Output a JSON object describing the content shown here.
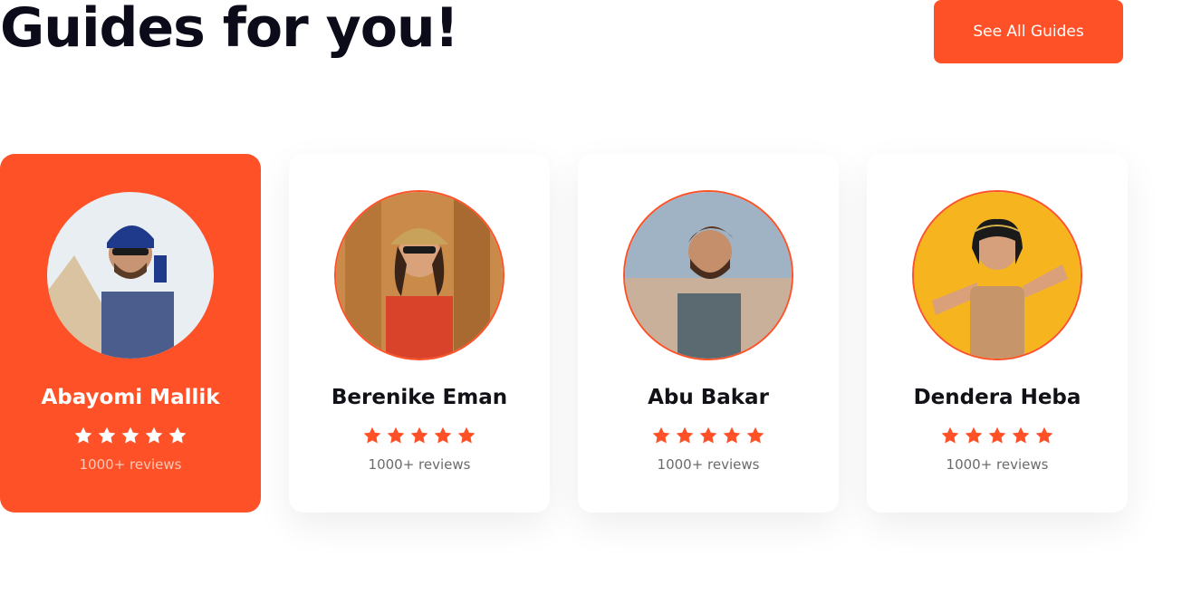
{
  "header": {
    "title": "Guides for you!",
    "see_all_label": "See All Guides"
  },
  "colors": {
    "accent": "#ff5127",
    "star_on_accent": "#ffffff",
    "star_default": "#ff5127"
  },
  "guides": [
    {
      "name": "Abayomi Mallik",
      "rating": 5,
      "reviews": "1000+ reviews",
      "active": true
    },
    {
      "name": "Berenike Eman",
      "rating": 5,
      "reviews": "1000+ reviews",
      "active": false
    },
    {
      "name": "Abu Bakar",
      "rating": 5,
      "reviews": "1000+ reviews",
      "active": false
    },
    {
      "name": "Dendera Heba",
      "rating": 5,
      "reviews": "1000+ reviews",
      "active": false
    }
  ]
}
